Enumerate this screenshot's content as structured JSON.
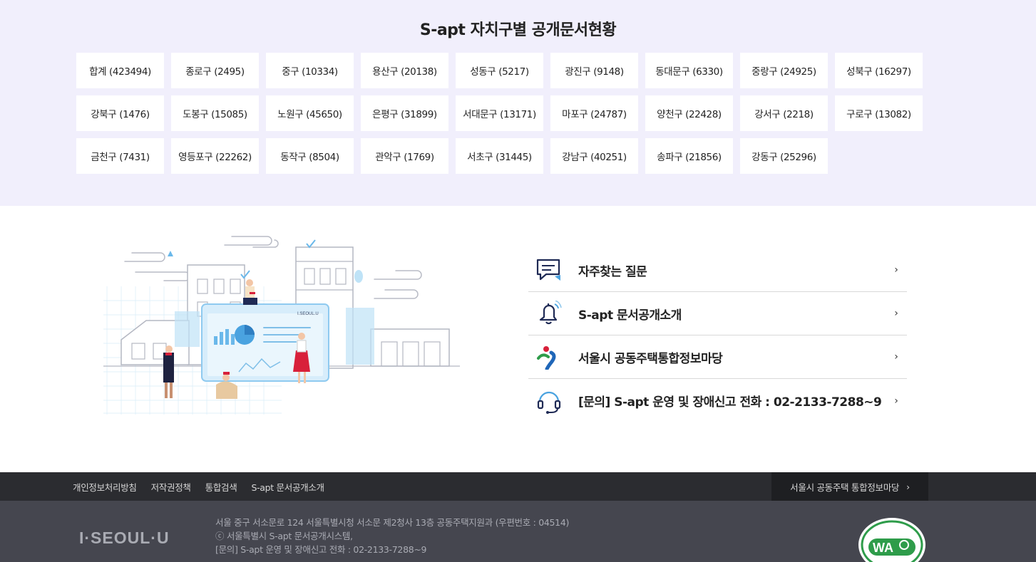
{
  "district_section": {
    "title": "S-apt 자치구별 공개문서현황",
    "districts": [
      "합계 (423494)",
      "종로구 (2495)",
      "중구 (10334)",
      "용산구 (20138)",
      "성동구 (5217)",
      "광진구 (9148)",
      "동대문구 (6330)",
      "중랑구 (24925)",
      "성북구 (16297)",
      "강북구 (1476)",
      "도봉구 (15085)",
      "노원구 (45650)",
      "은평구 (31899)",
      "서대문구 (13171)",
      "마포구 (24787)",
      "양천구 (22428)",
      "강서구 (2218)",
      "구로구 (13082)",
      "금천구 (7431)",
      "영등포구 (22262)",
      "동작구 (8504)",
      "관악구 (1769)",
      "서초구 (31445)",
      "강남구 (40251)",
      "송파구 (21856)",
      "강동구 (25296)"
    ]
  },
  "illustration": {
    "screen_label": "I.SEOUL.U"
  },
  "quick_links": [
    {
      "label": "자주찾는 질문",
      "icon": "chat-bubble-icon"
    },
    {
      "label": "S-apt 문서공개소개",
      "icon": "bell-icon"
    },
    {
      "label": "서울시 공동주택통합정보마당",
      "icon": "seoul-symbol-icon"
    },
    {
      "label": "[문의] S-apt 운영 및 장애신고 전화 : 02-2133-7288~9",
      "icon": "headset-icon"
    }
  ],
  "footer": {
    "links": [
      "개인정보처리방침",
      "저작권정책",
      "통합검색",
      "S-apt 문서공개소개"
    ],
    "site_link": "서울시 공동주택 통합정보마당",
    "logo": "I·SEOUL·U",
    "info_lines": [
      "서울 중구 서소문로 124 서울특별시청 서소문 제2청사 13층 공동주택지원과 (우편번호 : 04514)",
      "ⓒ 서울특별시 S-apt 문서공개시스템,",
      "[문의] S-apt 운영 및 장애신고 전화 : 02-2133-7288~9"
    ],
    "wa_mark_text": "WA"
  },
  "colors": {
    "section_bg": "#f1effc",
    "footer_top": "#2b2c30",
    "footer_bottom": "#45464f",
    "navy": "#1f2a55",
    "accent_blue": "#4aa3e0",
    "accent_red": "#d8203a"
  }
}
